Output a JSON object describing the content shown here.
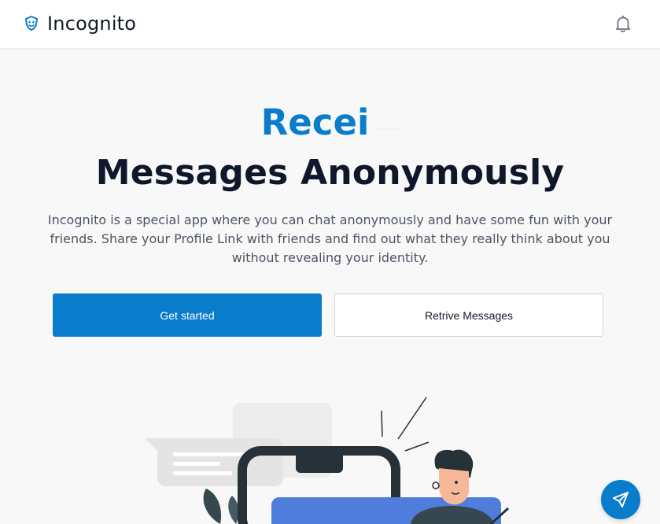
{
  "header": {
    "brand_name": "Incognito",
    "brand_icon": "masks-icon",
    "notification_icon": "bell-icon"
  },
  "hero": {
    "typed_text": "Recei",
    "title": "Messages Anonymously",
    "description": "Incognito is a special app where you can chat anonymously and have some fun with your friends. Share your Profile Link with friends and find out what they really think about you without revealing your identity."
  },
  "actions": {
    "primary_label": "Get started",
    "secondary_label": "Retrive Messages"
  },
  "fab": {
    "icon": "send-icon"
  },
  "colors": {
    "accent": "#0a7ccc",
    "text": "#0f172a",
    "muted": "#4b5563",
    "page_bg": "#f8f8f8"
  }
}
